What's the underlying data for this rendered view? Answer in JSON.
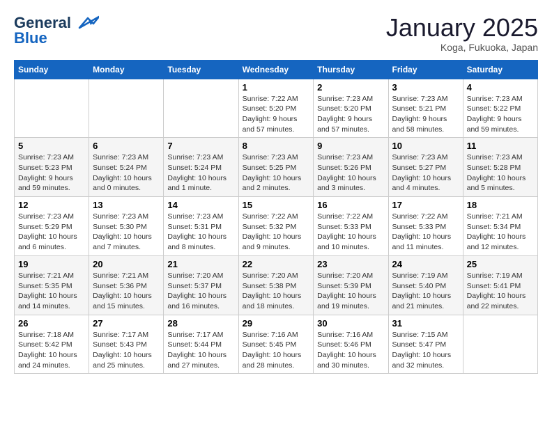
{
  "header": {
    "logo_line1": "General",
    "logo_line2": "Blue",
    "month": "January 2025",
    "location": "Koga, Fukuoka, Japan"
  },
  "weekdays": [
    "Sunday",
    "Monday",
    "Tuesday",
    "Wednesday",
    "Thursday",
    "Friday",
    "Saturday"
  ],
  "weeks": [
    [
      {
        "day": "",
        "info": ""
      },
      {
        "day": "",
        "info": ""
      },
      {
        "day": "",
        "info": ""
      },
      {
        "day": "1",
        "info": "Sunrise: 7:22 AM\nSunset: 5:20 PM\nDaylight: 9 hours\nand 57 minutes."
      },
      {
        "day": "2",
        "info": "Sunrise: 7:23 AM\nSunset: 5:20 PM\nDaylight: 9 hours\nand 57 minutes."
      },
      {
        "day": "3",
        "info": "Sunrise: 7:23 AM\nSunset: 5:21 PM\nDaylight: 9 hours\nand 58 minutes."
      },
      {
        "day": "4",
        "info": "Sunrise: 7:23 AM\nSunset: 5:22 PM\nDaylight: 9 hours\nand 59 minutes."
      }
    ],
    [
      {
        "day": "5",
        "info": "Sunrise: 7:23 AM\nSunset: 5:23 PM\nDaylight: 9 hours\nand 59 minutes."
      },
      {
        "day": "6",
        "info": "Sunrise: 7:23 AM\nSunset: 5:24 PM\nDaylight: 10 hours\nand 0 minutes."
      },
      {
        "day": "7",
        "info": "Sunrise: 7:23 AM\nSunset: 5:24 PM\nDaylight: 10 hours\nand 1 minute."
      },
      {
        "day": "8",
        "info": "Sunrise: 7:23 AM\nSunset: 5:25 PM\nDaylight: 10 hours\nand 2 minutes."
      },
      {
        "day": "9",
        "info": "Sunrise: 7:23 AM\nSunset: 5:26 PM\nDaylight: 10 hours\nand 3 minutes."
      },
      {
        "day": "10",
        "info": "Sunrise: 7:23 AM\nSunset: 5:27 PM\nDaylight: 10 hours\nand 4 minutes."
      },
      {
        "day": "11",
        "info": "Sunrise: 7:23 AM\nSunset: 5:28 PM\nDaylight: 10 hours\nand 5 minutes."
      }
    ],
    [
      {
        "day": "12",
        "info": "Sunrise: 7:23 AM\nSunset: 5:29 PM\nDaylight: 10 hours\nand 6 minutes."
      },
      {
        "day": "13",
        "info": "Sunrise: 7:23 AM\nSunset: 5:30 PM\nDaylight: 10 hours\nand 7 minutes."
      },
      {
        "day": "14",
        "info": "Sunrise: 7:23 AM\nSunset: 5:31 PM\nDaylight: 10 hours\nand 8 minutes."
      },
      {
        "day": "15",
        "info": "Sunrise: 7:22 AM\nSunset: 5:32 PM\nDaylight: 10 hours\nand 9 minutes."
      },
      {
        "day": "16",
        "info": "Sunrise: 7:22 AM\nSunset: 5:33 PM\nDaylight: 10 hours\nand 10 minutes."
      },
      {
        "day": "17",
        "info": "Sunrise: 7:22 AM\nSunset: 5:33 PM\nDaylight: 10 hours\nand 11 minutes."
      },
      {
        "day": "18",
        "info": "Sunrise: 7:21 AM\nSunset: 5:34 PM\nDaylight: 10 hours\nand 12 minutes."
      }
    ],
    [
      {
        "day": "19",
        "info": "Sunrise: 7:21 AM\nSunset: 5:35 PM\nDaylight: 10 hours\nand 14 minutes."
      },
      {
        "day": "20",
        "info": "Sunrise: 7:21 AM\nSunset: 5:36 PM\nDaylight: 10 hours\nand 15 minutes."
      },
      {
        "day": "21",
        "info": "Sunrise: 7:20 AM\nSunset: 5:37 PM\nDaylight: 10 hours\nand 16 minutes."
      },
      {
        "day": "22",
        "info": "Sunrise: 7:20 AM\nSunset: 5:38 PM\nDaylight: 10 hours\nand 18 minutes."
      },
      {
        "day": "23",
        "info": "Sunrise: 7:20 AM\nSunset: 5:39 PM\nDaylight: 10 hours\nand 19 minutes."
      },
      {
        "day": "24",
        "info": "Sunrise: 7:19 AM\nSunset: 5:40 PM\nDaylight: 10 hours\nand 21 minutes."
      },
      {
        "day": "25",
        "info": "Sunrise: 7:19 AM\nSunset: 5:41 PM\nDaylight: 10 hours\nand 22 minutes."
      }
    ],
    [
      {
        "day": "26",
        "info": "Sunrise: 7:18 AM\nSunset: 5:42 PM\nDaylight: 10 hours\nand 24 minutes."
      },
      {
        "day": "27",
        "info": "Sunrise: 7:17 AM\nSunset: 5:43 PM\nDaylight: 10 hours\nand 25 minutes."
      },
      {
        "day": "28",
        "info": "Sunrise: 7:17 AM\nSunset: 5:44 PM\nDaylight: 10 hours\nand 27 minutes."
      },
      {
        "day": "29",
        "info": "Sunrise: 7:16 AM\nSunset: 5:45 PM\nDaylight: 10 hours\nand 28 minutes."
      },
      {
        "day": "30",
        "info": "Sunrise: 7:16 AM\nSunset: 5:46 PM\nDaylight: 10 hours\nand 30 minutes."
      },
      {
        "day": "31",
        "info": "Sunrise: 7:15 AM\nSunset: 5:47 PM\nDaylight: 10 hours\nand 32 minutes."
      },
      {
        "day": "",
        "info": ""
      }
    ]
  ]
}
